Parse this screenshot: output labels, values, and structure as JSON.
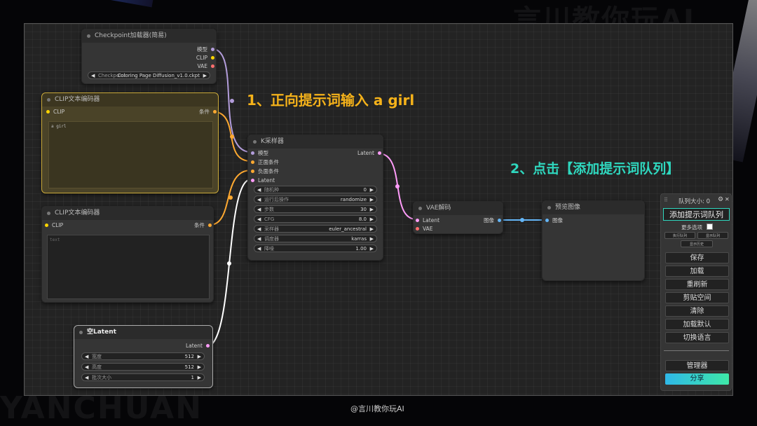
{
  "watermarks": {
    "top_right": "言川教你玩AI",
    "bottom_left": "YANCHUAN",
    "bottom_center": "@言川教你玩AI"
  },
  "annotations": {
    "step1": "1、正向提示词输入 a girl",
    "step2": "2、点击【添加提示词队列】",
    "step1_color": "#f5b21a",
    "step2_color": "#2fd7be"
  },
  "colors": {
    "model": "#b39ddb",
    "clip": "#ffd500",
    "vae": "#ff6e6e",
    "conditioning": "#ffa931",
    "latent": "#ff9cf9",
    "image": "#64b5f6",
    "wire_latent": "#ffffff"
  },
  "nodes": {
    "checkpoint": {
      "title": "Checkpoint加载器(简易)",
      "out_model": "模型",
      "out_clip": "CLIP",
      "out_vae": "VAE",
      "ckpt_label": "Checkpoint",
      "ckpt_value": "Coloring Page Diffusion_v1.0.ckpt"
    },
    "clip_pos": {
      "title": "CLIP文本编码器",
      "in_clip": "CLIP",
      "out_cond": "条件",
      "text": "a girl"
    },
    "clip_neg": {
      "title": "CLIP文本编码器",
      "in_clip": "CLIP",
      "out_cond": "条件",
      "text": "text"
    },
    "empty_latent": {
      "title": "空Latent",
      "out_latent": "Latent",
      "widgets": [
        {
          "label": "宽度",
          "value": "512"
        },
        {
          "label": "高度",
          "value": "512"
        },
        {
          "label": "批次大小",
          "value": "1"
        }
      ]
    },
    "ksampler": {
      "title": "K采样器",
      "in_model": "模型",
      "in_pos": "正面条件",
      "in_neg": "负面条件",
      "in_latent": "Latent",
      "out_latent": "Latent",
      "widgets": [
        {
          "label": "随机种",
          "value": "0"
        },
        {
          "label": "运行后操作",
          "value": "randomize"
        },
        {
          "label": "步数",
          "value": "30"
        },
        {
          "label": "CFG",
          "value": "8.0"
        },
        {
          "label": "采样器",
          "value": "euler_ancestral"
        },
        {
          "label": "调度器",
          "value": "karras"
        },
        {
          "label": "降噪",
          "value": "1.00"
        }
      ]
    },
    "vae_decode": {
      "title": "VAE解码",
      "in_latent": "Latent",
      "in_vae": "VAE",
      "out_image": "图像"
    },
    "preview": {
      "title": "预览图像",
      "in_image": "图像"
    }
  },
  "menu": {
    "queue_size": "队列大小: 0",
    "gear_icon": "gear-icon",
    "close": "✕",
    "queue_prompt": "添加提示词队列",
    "more_options": "更多选项",
    "small_buttons": [
      "执行队列",
      "显示队列",
      "显示历史"
    ],
    "buttons": [
      "保存",
      "加载",
      "重刷新",
      "剪贴空间",
      "清除",
      "加载默认",
      "切换语言"
    ],
    "manager": "管理器",
    "share": "分享"
  }
}
